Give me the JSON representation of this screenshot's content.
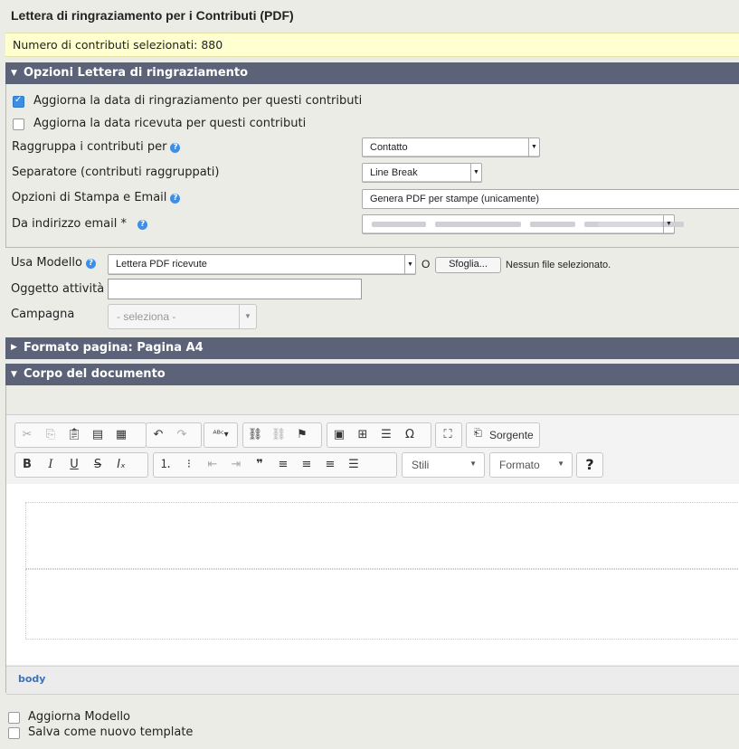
{
  "page": {
    "title": "Lettera di ringraziamento per i Contributi (PDF)"
  },
  "notice": {
    "text": "Numero di contributi selezionati: 880"
  },
  "options_section": {
    "title": "Opzioni Lettera di ringraziamento",
    "checkbox_thankyou": {
      "label": "Aggiorna la data di ringraziamento per questi contributi",
      "checked": true
    },
    "checkbox_receipt": {
      "label": "Aggiorna la data ricevuta per questi contributi",
      "checked": false
    },
    "group_by": {
      "label": "Raggruppa i contributi per",
      "value": "Contatto"
    },
    "separator": {
      "label": "Separatore (contributi raggruppati)",
      "value": "Line Break"
    },
    "print_email": {
      "label": "Opzioni di Stampa e Email",
      "value": "Genera PDF per stampe (unicamente)"
    },
    "from_email": {
      "label": "Da indirizzo email",
      "required_mark": "*"
    }
  },
  "template": {
    "label": "Usa Modello",
    "value": "Lettera PDF ricevute",
    "or_text": "O",
    "browse_button": "Sfoglia...",
    "no_file": "Nessun file selezionato."
  },
  "activity_subject": {
    "label": "Oggetto attività",
    "value": ""
  },
  "campaign": {
    "label": "Campagna",
    "value": "- seleziona -"
  },
  "page_format": {
    "title": "Formato pagina: Pagina A4"
  },
  "document_body": {
    "title": "Corpo del documento",
    "source_button": "Sorgente",
    "styles_combo": "Stili",
    "format_combo": "Formato",
    "help_button": "?",
    "path": "body"
  },
  "footer": {
    "update_template": "Aggiorna Modello",
    "save_new_template": "Salva come nuovo template"
  },
  "colors": {
    "section_bar": "#5c6378",
    "notice_bg": "#ffffcf",
    "accent": "#3d8ee6"
  }
}
